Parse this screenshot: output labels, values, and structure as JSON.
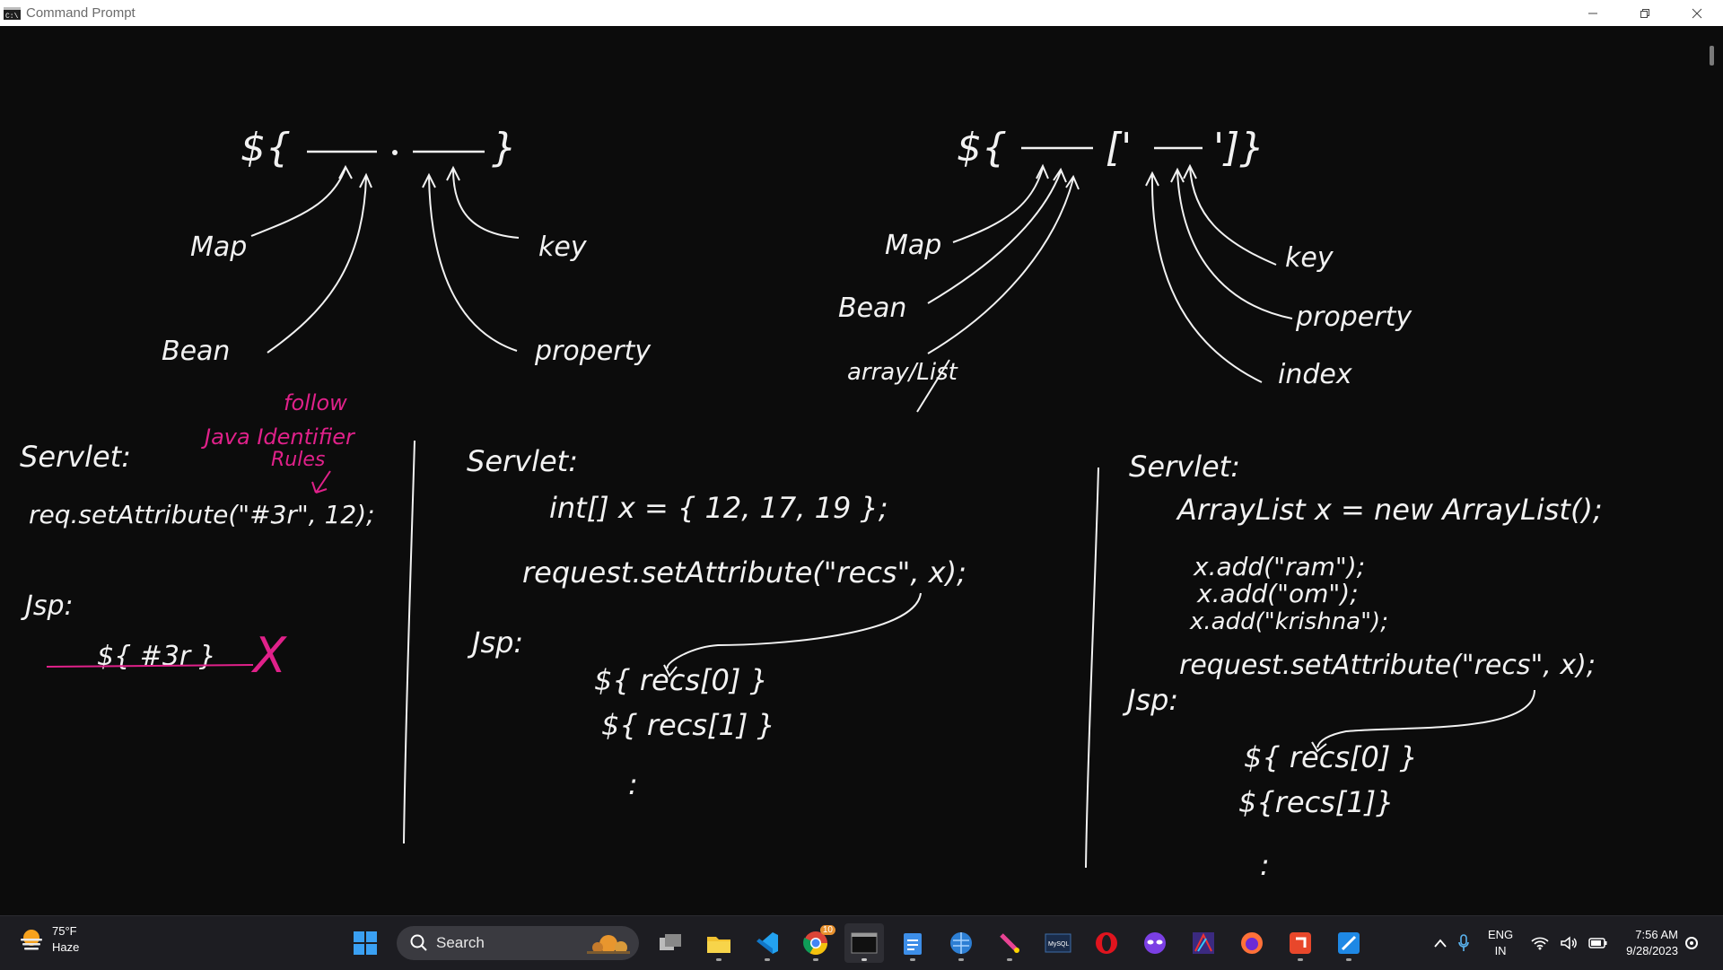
{
  "window": {
    "title": "Command Prompt"
  },
  "canvas": {
    "top_left": {
      "expr": "${ ___ . ___ }",
      "labels": [
        "Map",
        "Bean",
        "key",
        "property"
      ]
    },
    "top_right": {
      "expr": "${ ___ [' ___ '] }",
      "labels": [
        "Map",
        "Bean",
        "array/List",
        "key",
        "property",
        "index"
      ]
    },
    "col1": {
      "heading": "Servlet:",
      "note": [
        "follow",
        "Java Identifier",
        "Rules"
      ],
      "code": "req.setAttribute(\"#3r\", 12);",
      "jsp": "Jsp:",
      "jsp_expr": "${ #3r }",
      "mark": "X"
    },
    "col2": {
      "heading": "Servlet:",
      "line1": "int[]   x  =  { 12, 17, 19 };",
      "line2": "request.setAttribute(\"recs\", x);",
      "jsp": "Jsp:",
      "e1": "${ recs[0] }",
      "e2": "${ recs[1] }",
      "dots": ":"
    },
    "col3": {
      "heading": "Servlet:",
      "line1": "ArrayList  x  =  new ArrayList();",
      "add1": "x.add(\"ram\");",
      "add2": "x.add(\"om\");",
      "add3": "x.add(\"krishna\");",
      "line2": "request.setAttribute(\"recs\",   x);",
      "jsp": "Jsp:",
      "e1": "${ recs[0] }",
      "e2": "${recs[1]}",
      "dots": ":"
    }
  },
  "taskbar": {
    "weather": {
      "temp": "75°F",
      "desc": "Haze"
    },
    "search_label": "Search",
    "lang": {
      "line1": "ENG",
      "line2": "IN"
    },
    "clock": {
      "time": "7:56 AM",
      "date": "9/28/2023"
    },
    "badge": "10"
  },
  "colors": {
    "ink": "#f2f2f2",
    "pink_ink": "#e0218a",
    "console_bg": "#0c0c0c",
    "taskbar_bg": "#1d1d22"
  }
}
